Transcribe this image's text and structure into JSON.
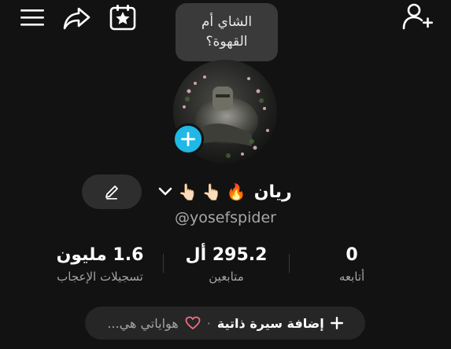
{
  "topbar": {
    "menu_icon": "hamburger-menu-icon",
    "share_icon": "share-arrow-icon",
    "calendar_icon": "calendar-star-icon",
    "add_user_icon": "add-user-icon"
  },
  "tooltip": {
    "line1": "الشاي أم",
    "line2": "القهوة؟"
  },
  "profile": {
    "name": "ريان",
    "emojis": [
      "🔥",
      "👆🏻",
      "👆🏻"
    ],
    "handle": "@yosefspider",
    "accent": "#20b8e6"
  },
  "stats": [
    {
      "value": "0",
      "label": "أتابعه"
    },
    {
      "value": "295.2 أل",
      "label": "متابعين"
    },
    {
      "value": "1.6 مليون",
      "label": "تسجيلات الإعجاب"
    }
  ],
  "bio": {
    "add_label": "إضافة سيرة ذاتية",
    "separator": "·",
    "hobbies_label": "هواياتي هي..."
  }
}
